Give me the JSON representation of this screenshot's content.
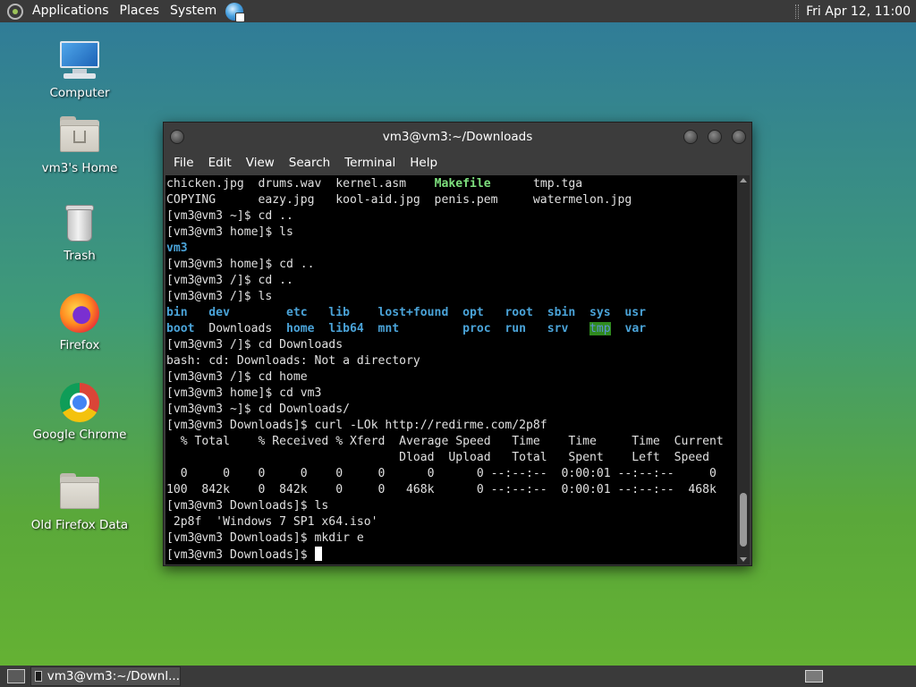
{
  "top_panel": {
    "menus": [
      "Applications",
      "Places",
      "System"
    ],
    "clock": "Fri Apr 12, 11:00"
  },
  "desktop_icons": [
    {
      "label": "Computer"
    },
    {
      "label": "vm3's Home"
    },
    {
      "label": "Trash"
    },
    {
      "label": "Firefox"
    },
    {
      "label": "Google Chrome"
    },
    {
      "label": "Old Firefox Data"
    }
  ],
  "terminal": {
    "title": "vm3@vm3:~/Downloads",
    "menu": [
      "File",
      "Edit",
      "View",
      "Search",
      "Terminal",
      "Help"
    ],
    "lines": {
      "l0a": "chicken.jpg  drums.wav  kernel.asm    ",
      "l0b": "Makefile",
      "l0c": "      tmp.tga",
      "l1": "COPYING      eazy.jpg   kool-aid.jpg  penis.pem     watermelon.jpg",
      "l2": "[vm3@vm3 ~]$ cd ..",
      "l3": "[vm3@vm3 home]$ ls",
      "l4": "vm3",
      "l5": "[vm3@vm3 home]$ cd ..",
      "l6": "[vm3@vm3 /]$ cd ..",
      "l7": "[vm3@vm3 /]$ ls",
      "l8": "bin   dev        etc   lib    lost+found  opt   root  sbin  sys  usr",
      "l9a": "boot",
      "l9b": "  Downloads  ",
      "l9c": "home  lib64  mnt         proc  run   srv   ",
      "l9d": "tmp",
      "l9e": "  var",
      "l10": "[vm3@vm3 /]$ cd Downloads",
      "l11": "bash: cd: Downloads: Not a directory",
      "l12": "[vm3@vm3 /]$ cd home",
      "l13": "[vm3@vm3 home]$ cd vm3",
      "l14": "[vm3@vm3 ~]$ cd Downloads/",
      "l15": "[vm3@vm3 Downloads]$ curl -LOk http://redirme.com/2p8f",
      "l16": "  % Total    % Received % Xferd  Average Speed   Time    Time     Time  Current",
      "l17": "                                 Dload  Upload   Total   Spent    Left  Speed",
      "l18": "  0     0    0     0    0     0      0      0 --:--:--  0:00:01 --:--:--     0",
      "l19": "100  842k    0  842k    0     0   468k      0 --:--:--  0:00:01 --:--:--  468k",
      "l20": "[vm3@vm3 Downloads]$ ls",
      "l21": " 2p8f  'Windows 7 SP1 x64.iso'",
      "l22": "[vm3@vm3 Downloads]$ mkdir e",
      "l23": "[vm3@vm3 Downloads]$ "
    }
  },
  "taskbar": {
    "task_label": "vm3@vm3:~/Downl..."
  },
  "colors": {
    "dir": "#4aa3d8",
    "exec": "#7ee07e",
    "tmp_bg": "#2f8a1e"
  }
}
